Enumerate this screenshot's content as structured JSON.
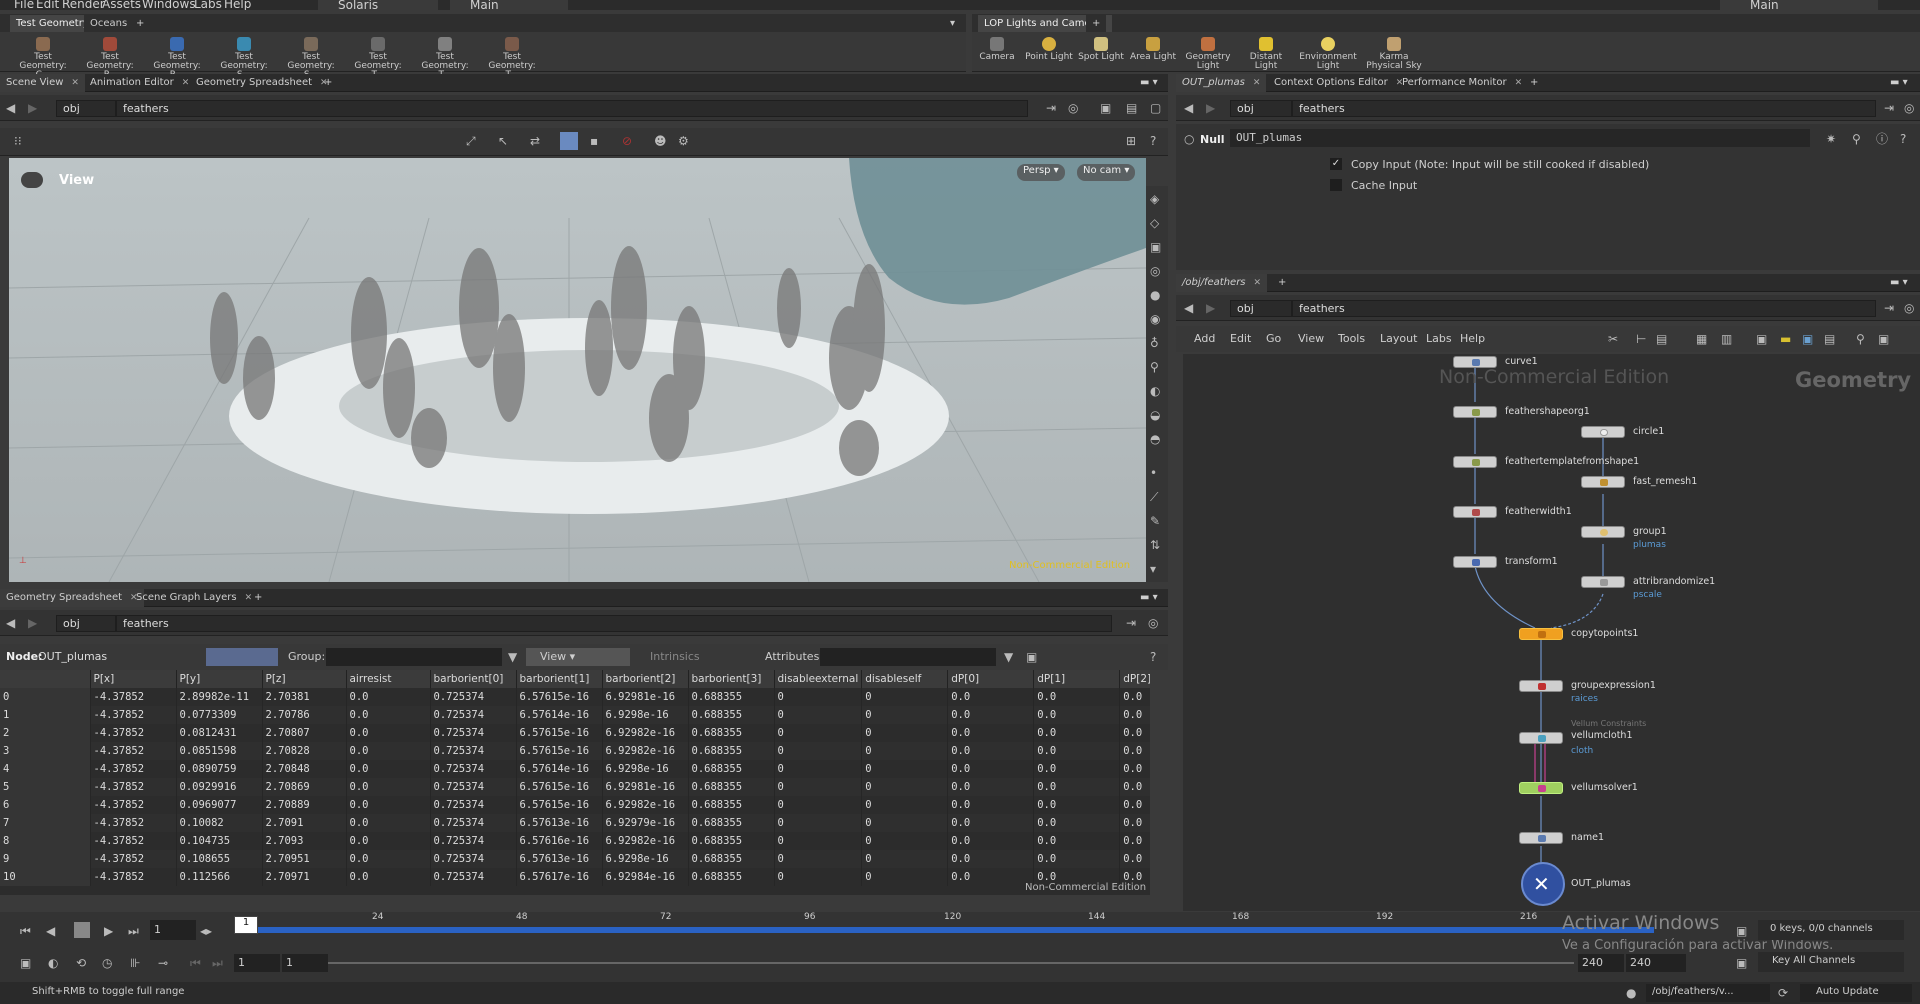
{
  "menu": {
    "items": [
      "File",
      "Edit",
      "Render",
      "Assets",
      "Windows",
      "Labs",
      "Help"
    ],
    "desktop": "Solaris",
    "network": "Main",
    "right_desktop": "Main"
  },
  "shelf_left": {
    "tabs": [
      "Test Geometry",
      "Oceans"
    ],
    "tools": [
      "Test Geometry: C...",
      "Test Geometry: P...",
      "Test Geometry: R...",
      "Test Geometry: S...",
      "Test Geometry: S...",
      "Test Geometry: T...",
      "Test Geometry: T...",
      "Test Geometry: T..."
    ]
  },
  "shelf_right": {
    "tabs": [
      "LOP Lights and Cameras"
    ],
    "tools": [
      "Camera",
      "Point Light",
      "Spot Light",
      "Area Light",
      "Geometry Light",
      "Distant Light",
      "Environment Light",
      "Karma Physical Sky"
    ]
  },
  "left_tabs": [
    "Scene View",
    "Animation Editor",
    "Geometry Spreadsheet"
  ],
  "path": {
    "obj": "obj",
    "node": "feathers"
  },
  "viewport": {
    "title": "View",
    "persp": "Persp",
    "cam": "No cam",
    "watermark": "Non-Commercial Edition"
  },
  "sheet_tabs": [
    "Geometry Spreadsheet",
    "Scene Graph Layers"
  ],
  "sheet_bar": {
    "node_label": "Node:",
    "node": "OUT_plumas",
    "group_label": "Group:",
    "view": "View",
    "intrinsics": "Intrinsics",
    "attributes_label": "Attributes:"
  },
  "sheet": {
    "columns": [
      "",
      "P[x]",
      "P[y]",
      "P[z]",
      "airresist",
      "barborient[0]",
      "barborient[1]",
      "barborient[2]",
      "barborient[3]",
      "disableexternal",
      "disableself",
      "dP[0]",
      "dP[1]",
      "dP[2]"
    ],
    "rows": [
      [
        "0",
        "-4.37852",
        "2.89982e-11",
        "2.70381",
        "0.0",
        "0.725374",
        "6.57615e-16",
        "6.92981e-16",
        "0.688355",
        "0",
        "0",
        "0.0",
        "0.0",
        "0.0"
      ],
      [
        "1",
        "-4.37852",
        "0.0773309",
        "2.70786",
        "0.0",
        "0.725374",
        "6.57614e-16",
        "6.9298e-16",
        "0.688355",
        "0",
        "0",
        "0.0",
        "0.0",
        "0.0"
      ],
      [
        "2",
        "-4.37852",
        "0.0812431",
        "2.70807",
        "0.0",
        "0.725374",
        "6.57615e-16",
        "6.92982e-16",
        "0.688355",
        "0",
        "0",
        "0.0",
        "0.0",
        "0.0"
      ],
      [
        "3",
        "-4.37852",
        "0.0851598",
        "2.70828",
        "0.0",
        "0.725374",
        "6.57615e-16",
        "6.92982e-16",
        "0.688355",
        "0",
        "0",
        "0.0",
        "0.0",
        "0.0"
      ],
      [
        "4",
        "-4.37852",
        "0.0890759",
        "2.70848",
        "0.0",
        "0.725374",
        "6.57614e-16",
        "6.9298e-16",
        "0.688355",
        "0",
        "0",
        "0.0",
        "0.0",
        "0.0"
      ],
      [
        "5",
        "-4.37852",
        "0.0929916",
        "2.70869",
        "0.0",
        "0.725374",
        "6.57615e-16",
        "6.92981e-16",
        "0.688355",
        "0",
        "0",
        "0.0",
        "0.0",
        "0.0"
      ],
      [
        "6",
        "-4.37852",
        "0.0969077",
        "2.70889",
        "0.0",
        "0.725374",
        "6.57615e-16",
        "6.92982e-16",
        "0.688355",
        "0",
        "0",
        "0.0",
        "0.0",
        "0.0"
      ],
      [
        "7",
        "-4.37852",
        "0.10082",
        "2.7091",
        "0.0",
        "0.725374",
        "6.57613e-16",
        "6.92979e-16",
        "0.688355",
        "0",
        "0",
        "0.0",
        "0.0",
        "0.0"
      ],
      [
        "8",
        "-4.37852",
        "0.104735",
        "2.7093",
        "0.0",
        "0.725374",
        "6.57616e-16",
        "6.92982e-16",
        "0.688355",
        "0",
        "0",
        "0.0",
        "0.0",
        "0.0"
      ],
      [
        "9",
        "-4.37852",
        "0.108655",
        "2.70951",
        "0.0",
        "0.725374",
        "6.57613e-16",
        "6.9298e-16",
        "0.688355",
        "0",
        "0",
        "0.0",
        "0.0",
        "0.0"
      ],
      [
        "10",
        "-4.37852",
        "0.112566",
        "2.70971",
        "0.0",
        "0.725374",
        "6.57617e-16",
        "6.92984e-16",
        "0.688355",
        "0",
        "0",
        "0.0",
        "0.0",
        "0.0"
      ]
    ],
    "watermark": "Non-Commercial Edition"
  },
  "right_tabs": [
    "OUT_plumas",
    "Context Options Editor",
    "Performance Monitor"
  ],
  "params": {
    "type": "Null",
    "name": "OUT_plumas",
    "copy_input": "Copy Input (Note: Input will be still cooked if disabled)",
    "cache_input": "Cache Input"
  },
  "net_tabs": [
    "/obj/feathers"
  ],
  "net_menu": [
    "Add",
    "Edit",
    "Go",
    "View",
    "Tools",
    "Layout",
    "Labs",
    "Help"
  ],
  "net": {
    "watermark": "Non-Commercial Edition",
    "context": "Geometry",
    "nodes": [
      {
        "name": "curve1"
      },
      {
        "name": "feathershapeorg1"
      },
      {
        "name": "feathertemplatefromshape1"
      },
      {
        "name": "featherwidth1"
      },
      {
        "name": "transform1"
      },
      {
        "name": "circle1"
      },
      {
        "name": "fast_remesh1"
      },
      {
        "name": "group1",
        "sub": "plumas"
      },
      {
        "name": "attribrandomize1",
        "sub": "pscale"
      },
      {
        "name": "copytopoints1"
      },
      {
        "name": "groupexpression1",
        "sub": "raices"
      },
      {
        "name": "vellumcloth1",
        "sub": "cloth",
        "pre": "Vellum Constraints"
      },
      {
        "name": "vellumsolver1"
      },
      {
        "name": "name1"
      },
      {
        "name": "OUT_plumas"
      }
    ]
  },
  "timeline": {
    "frame": "1",
    "ticks": [
      "24",
      "48",
      "72",
      "96",
      "120",
      "144",
      "168",
      "192",
      "216"
    ],
    "current": "1",
    "start": "1",
    "start2": "1",
    "end": "240",
    "end2": "240",
    "keys": "0 keys, 0/0 channels",
    "key_all": "Key All Channels",
    "status": "Shift+RMB to toggle full range",
    "path": "/obj/feathers/v...",
    "update": "Auto Update",
    "activate": "Activar Windows",
    "activate_sub": "Ve a Configuración para activar Windows."
  }
}
